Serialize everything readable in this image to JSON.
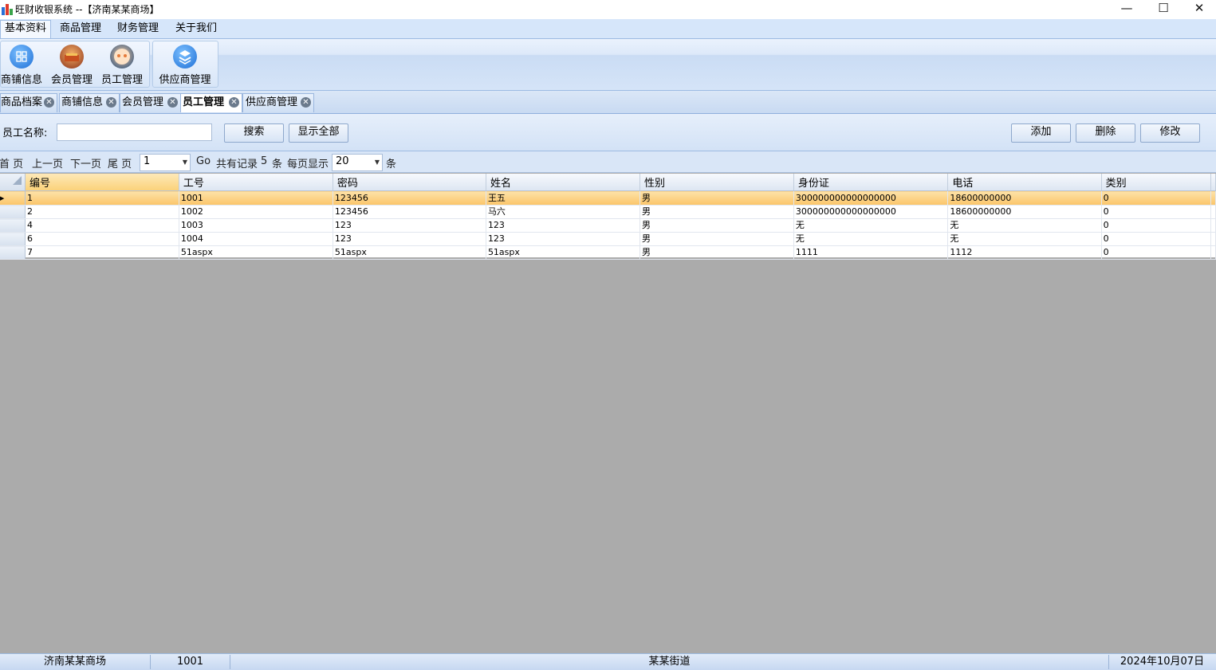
{
  "window": {
    "title": "旺财收银系统 --【济南某某商场】",
    "minimize": "—",
    "maximize": "☐",
    "close": "✕"
  },
  "menu": [
    "基本资料",
    "商品管理",
    "财务管理",
    "关于我们"
  ],
  "ribbon": [
    {
      "label": "商铺信息",
      "icon": "shop-icon",
      "color": "#2f7fe0"
    },
    {
      "label": "会员管理",
      "icon": "member-icon",
      "color": "#a5381e"
    },
    {
      "label": "员工管理",
      "icon": "employee-icon",
      "color": "#f0a060"
    },
    {
      "label": "供应商管理",
      "icon": "supplier-icon",
      "color": "#2f7fe0"
    }
  ],
  "doc_tabs": [
    {
      "label": "商品档案",
      "active": false
    },
    {
      "label": "商铺信息",
      "active": false
    },
    {
      "label": "会员管理",
      "active": false
    },
    {
      "label": "员工管理",
      "active": true
    },
    {
      "label": "供应商管理",
      "active": false
    }
  ],
  "search": {
    "name_label": "员工名称:",
    "name_value": "",
    "search_btn": "搜索",
    "show_all_btn": "显示全部",
    "add_btn": "添加",
    "delete_btn": "删除",
    "edit_btn": "修改"
  },
  "pager": {
    "first": "首 页",
    "prev": "上一页",
    "next": "下一页",
    "last": "尾 页",
    "page_value": "1",
    "go": "Go",
    "total_prefix": "共有记录",
    "total": "5",
    "total_suffix": "条",
    "per_page_label": "每页显示",
    "per_page_value": "20",
    "per_page_suffix": "条"
  },
  "grid": {
    "columns": [
      "编号",
      "工号",
      "密码",
      "姓名",
      "性别",
      "身份证",
      "电话",
      "类别"
    ],
    "rows": [
      [
        "1",
        "1001",
        "123456",
        "王五",
        "男",
        "300000000000000000",
        "18600000000",
        "0"
      ],
      [
        "2",
        "1002",
        "123456",
        "马六",
        "男",
        "300000000000000000",
        "18600000000",
        "0"
      ],
      [
        "4",
        "1003",
        "123",
        "123",
        "男",
        "无",
        "无",
        "0"
      ],
      [
        "6",
        "1004",
        "123",
        "123",
        "男",
        "无",
        "无",
        "0"
      ],
      [
        "7",
        "51aspx",
        "51aspx",
        "51aspx",
        "男",
        "1111",
        "1112",
        "0"
      ]
    ],
    "selected_row": 0
  },
  "status": {
    "store": "济南某某商场",
    "user": "1001",
    "address": "某某街道",
    "date": "2024年10月07日"
  }
}
